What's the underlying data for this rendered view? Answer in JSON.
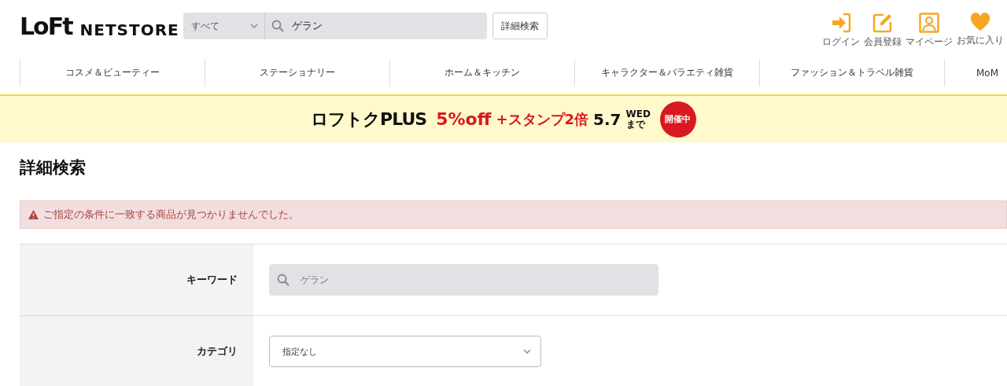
{
  "header": {
    "logo_main": "LoFt",
    "logo_sub": "NETSTORE",
    "search_scope": "すべて",
    "search_value": "ゲラン",
    "advanced_button": "詳細検索",
    "user_links": [
      {
        "label": "ログイン"
      },
      {
        "label": "会員登録"
      },
      {
        "label": "マイページ"
      },
      {
        "label": "お気に入り"
      }
    ]
  },
  "nav": [
    "コスメ＆ビューティー",
    "ステーショナリー",
    "ホーム＆キッチン",
    "キャラクター＆バラエティ雑貨",
    "ファッション＆トラベル雑貨",
    "MoM"
  ],
  "banner": {
    "brand": "ロフトクPLUS",
    "offer": "5%off",
    "bonus": "+スタンプ2倍",
    "date": "5.7",
    "weekday": "WED",
    "until": "まで",
    "badge": "開催中"
  },
  "page_title": "詳細検索",
  "alert": "ご指定の条件に一致する商品が見つかりませんでした。",
  "form": [
    {
      "kind": "search",
      "label": "キーワード",
      "value": "ゲラン"
    },
    {
      "kind": "select",
      "label": "カテゴリ",
      "value": "指定なし"
    }
  ]
}
